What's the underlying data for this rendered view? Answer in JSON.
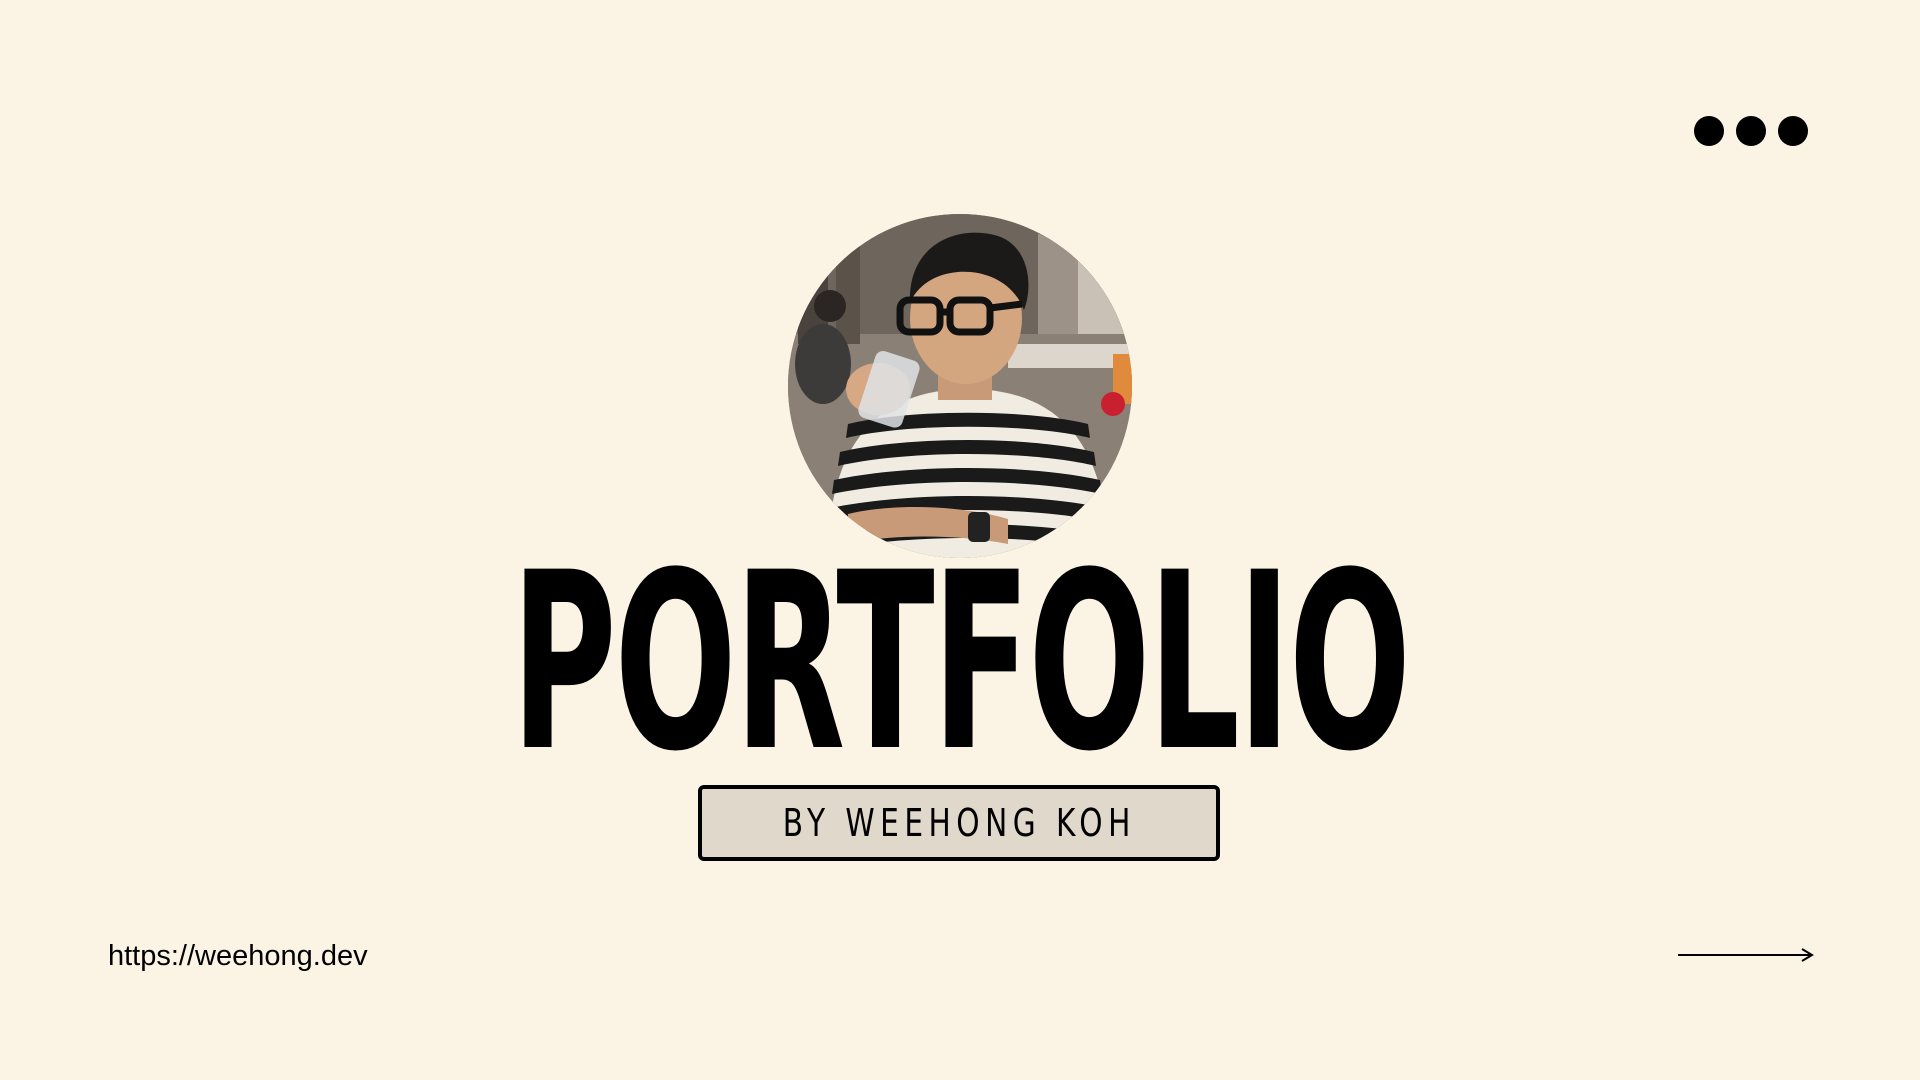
{
  "hero": {
    "title": "PORTFOLIO",
    "subtitle": "BY WEEHONG KOH",
    "url": "https://weehong.dev"
  },
  "colors": {
    "background": "#fbf4e5",
    "text": "#000000",
    "subtitle_box": "#e0d8cb"
  },
  "icons": {
    "menu": "more-dots-icon",
    "next": "arrow-right-icon",
    "photo": "profile-photo"
  }
}
